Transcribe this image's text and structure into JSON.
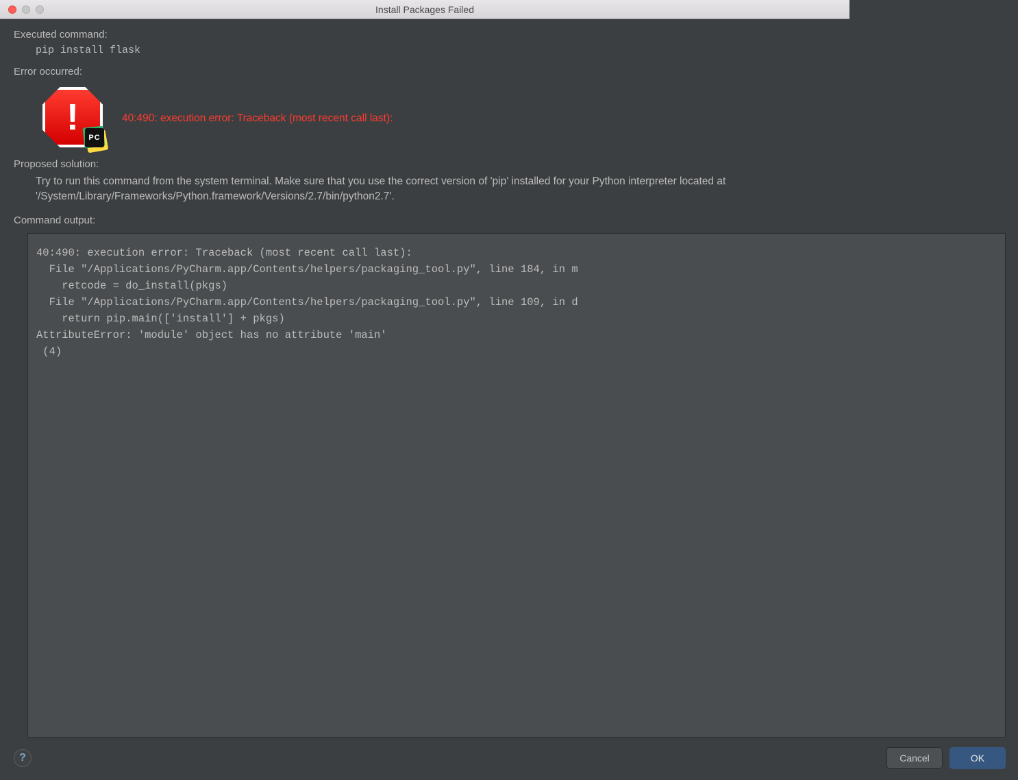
{
  "window": {
    "title": "Install Packages Failed"
  },
  "sections": {
    "executed_label": "Executed command:",
    "executed_command": "pip install flask",
    "error_label": "Error occurred:",
    "error_message": "40:490: execution error: Traceback (most recent call last):",
    "solution_label": "Proposed solution:",
    "solution_text": "Try to run this command from the system terminal. Make sure that you use the correct version of 'pip' installed for your Python interpreter located at '/System/Library/Frameworks/Python.framework/Versions/2.7/bin/python2.7'.",
    "output_label": "Command output:",
    "command_output": "40:490: execution error: Traceback (most recent call last):\n  File \"/Applications/PyCharm.app/Contents/helpers/packaging_tool.py\", line 184, in m\n    retcode = do_install(pkgs)\n  File \"/Applications/PyCharm.app/Contents/helpers/packaging_tool.py\", line 109, in d\n    return pip.main(['install'] + pkgs)\nAttributeError: 'module' object has no attribute 'main'\n (4)"
  },
  "icons": {
    "stop_glyph": "!",
    "pycharm_badge": "PC",
    "help_glyph": "?"
  },
  "buttons": {
    "cancel": "Cancel",
    "ok": "OK"
  }
}
